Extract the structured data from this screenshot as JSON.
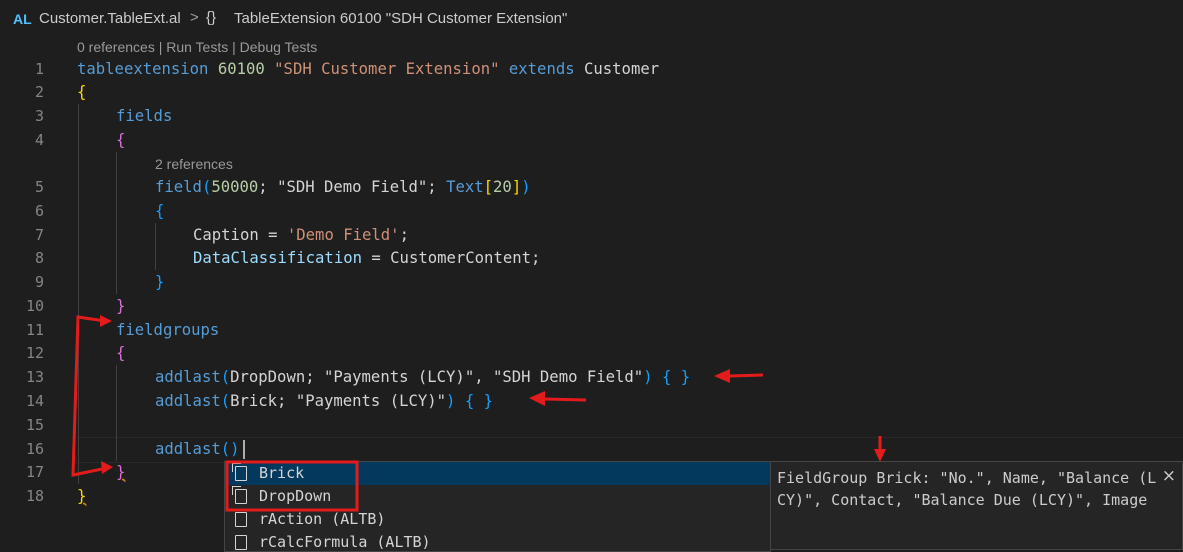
{
  "breadcrumb": {
    "language_badge": "AL",
    "file": "Customer.TableExt.al",
    "separator": ">",
    "symbol_icon": "{}",
    "symbol": "TableExtension 60100 \"SDH Customer Extension\""
  },
  "code_lens": [
    "0 references | Run Tests | Debug Tests",
    "2 references"
  ],
  "line_numbers": [
    "1",
    "2",
    "3",
    "4",
    "5",
    "6",
    "7",
    "8",
    "9",
    "10",
    "11",
    "12",
    "13",
    "14",
    "15",
    "16",
    "17",
    "18"
  ],
  "code": {
    "l1": [
      "tableextension",
      "60100",
      "\"SDH Customer Extension\"",
      "extends",
      "Customer"
    ],
    "l2": [
      "{"
    ],
    "l3": [
      "fields"
    ],
    "l4": [
      "{"
    ],
    "l5": [
      "field",
      "(",
      "50000",
      "; ",
      "\"SDH Demo Field\"",
      "; ",
      "Text",
      "[",
      "20",
      "]",
      ")"
    ],
    "l6": [
      "{"
    ],
    "l7": [
      "Caption",
      " = ",
      "'Demo Field'",
      ";"
    ],
    "l8": [
      "DataClassification",
      " = ",
      "CustomerContent",
      ";"
    ],
    "l9": [
      "}"
    ],
    "l10": [
      "}"
    ],
    "l11": [
      "fieldgroups"
    ],
    "l12": [
      "{"
    ],
    "l13": [
      "addlast",
      "(",
      "DropDown; \"Payments (LCY)\", \"SDH Demo Field\"",
      ")",
      " { }"
    ],
    "l14": [
      "addlast",
      "(",
      "Brick; \"Payments (LCY)\"",
      ")",
      " { }"
    ],
    "l16": [
      "addlast",
      "(",
      ")"
    ],
    "l17": [
      "}"
    ],
    "l18": [
      "}"
    ]
  },
  "suggestions": [
    {
      "label": "Brick",
      "icon": "field-group-icon",
      "selected": true
    },
    {
      "label": "DropDown",
      "icon": "field-group-icon",
      "selected": false
    },
    {
      "label": "rAction (ALTB)",
      "icon": "snippet-icon",
      "selected": false
    },
    {
      "label": "rCalcFormula (ALTB)",
      "icon": "snippet-icon",
      "selected": false
    }
  ],
  "details": {
    "text": "FieldGroup Brick: \"No.\", Name, \"Balance (LCY)\", Contact, \"Balance Due (LCY)\", Image",
    "close": "×"
  },
  "annotation_color": "#e31b1b",
  "colors": {
    "background": "#1e1e1e",
    "keyword": "#569cd6",
    "string": "#ce9178",
    "number": "#b5cea8",
    "function": "#dcdcaa",
    "type": "#4ec9b0",
    "variable": "#9cdcfe",
    "selection": "#04395e"
  }
}
